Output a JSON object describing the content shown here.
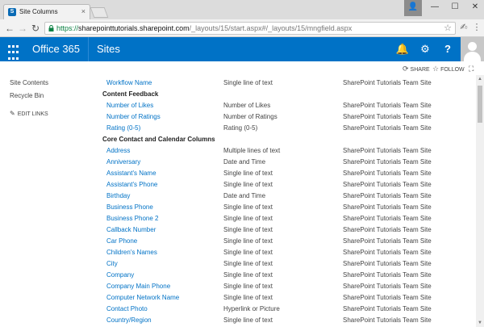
{
  "browser": {
    "tab_title": "Site Columns",
    "tab_favicon": "S",
    "close_glyph": "×",
    "url_scheme": "https://",
    "url_host": "sharepointtutorials.sharepoint.com",
    "url_path": "/_layouts/15/start.aspx#/_layouts/15/mngfield.aspx",
    "back_icon": "arrow-left-icon",
    "back_glyph": "←",
    "forward_glyph": "→",
    "reload_glyph": "↻",
    "star_glyph": "☆",
    "user_glyph": "👤",
    "min_glyph": "—",
    "max_glyph": "☐",
    "win_close_glyph": "✕",
    "ext1_glyph": "✍",
    "menu_glyph": "⋮"
  },
  "suite": {
    "brand": "Office 365",
    "app": "Sites",
    "bell_glyph": "🔔",
    "gear_glyph": "⚙",
    "help_glyph": "?",
    "accent": "#0072c6"
  },
  "actions": {
    "share": "SHARE",
    "follow": "FOLLOW",
    "share_glyph": "⟳",
    "follow_glyph": "☆",
    "focus_glyph": "⛶"
  },
  "leftnav": {
    "items": [
      "Site Contents",
      "Recycle Bin"
    ],
    "edit_links": "EDIT LINKS",
    "edit_glyph": "✎"
  },
  "table": {
    "top_row": {
      "name": "Workflow Name",
      "type": "Single line of text",
      "source": "SharePoint Tutorials Team Site"
    },
    "groups": [
      {
        "title": "Content Feedback",
        "rows": [
          {
            "name": "Number of Likes",
            "type": "Number of Likes",
            "source": "SharePoint Tutorials Team Site"
          },
          {
            "name": "Number of Ratings",
            "type": "Number of Ratings",
            "source": "SharePoint Tutorials Team Site"
          },
          {
            "name": "Rating (0-5)",
            "type": "Rating (0-5)",
            "source": "SharePoint Tutorials Team Site"
          }
        ]
      },
      {
        "title": "Core Contact and Calendar Columns",
        "rows": [
          {
            "name": "Address",
            "type": "Multiple lines of text",
            "source": "SharePoint Tutorials Team Site"
          },
          {
            "name": "Anniversary",
            "type": "Date and Time",
            "source": "SharePoint Tutorials Team Site"
          },
          {
            "name": "Assistant's Name",
            "type": "Single line of text",
            "source": "SharePoint Tutorials Team Site"
          },
          {
            "name": "Assistant's Phone",
            "type": "Single line of text",
            "source": "SharePoint Tutorials Team Site"
          },
          {
            "name": "Birthday",
            "type": "Date and Time",
            "source": "SharePoint Tutorials Team Site"
          },
          {
            "name": "Business Phone",
            "type": "Single line of text",
            "source": "SharePoint Tutorials Team Site"
          },
          {
            "name": "Business Phone 2",
            "type": "Single line of text",
            "source": "SharePoint Tutorials Team Site"
          },
          {
            "name": "Callback Number",
            "type": "Single line of text",
            "source": "SharePoint Tutorials Team Site"
          },
          {
            "name": "Car Phone",
            "type": "Single line of text",
            "source": "SharePoint Tutorials Team Site"
          },
          {
            "name": "Children's Names",
            "type": "Single line of text",
            "source": "SharePoint Tutorials Team Site"
          },
          {
            "name": "City",
            "type": "Single line of text",
            "source": "SharePoint Tutorials Team Site"
          },
          {
            "name": "Company",
            "type": "Single line of text",
            "source": "SharePoint Tutorials Team Site"
          },
          {
            "name": "Company Main Phone",
            "type": "Single line of text",
            "source": "SharePoint Tutorials Team Site"
          },
          {
            "name": "Computer Network Name",
            "type": "Single line of text",
            "source": "SharePoint Tutorials Team Site"
          },
          {
            "name": "Contact Photo",
            "type": "Hyperlink or Picture",
            "source": "SharePoint Tutorials Team Site"
          },
          {
            "name": "Country/Region",
            "type": "Single line of text",
            "source": "SharePoint Tutorials Team Site"
          }
        ]
      }
    ]
  },
  "scroll": {
    "up_glyph": "▲",
    "down_glyph": "▼"
  }
}
